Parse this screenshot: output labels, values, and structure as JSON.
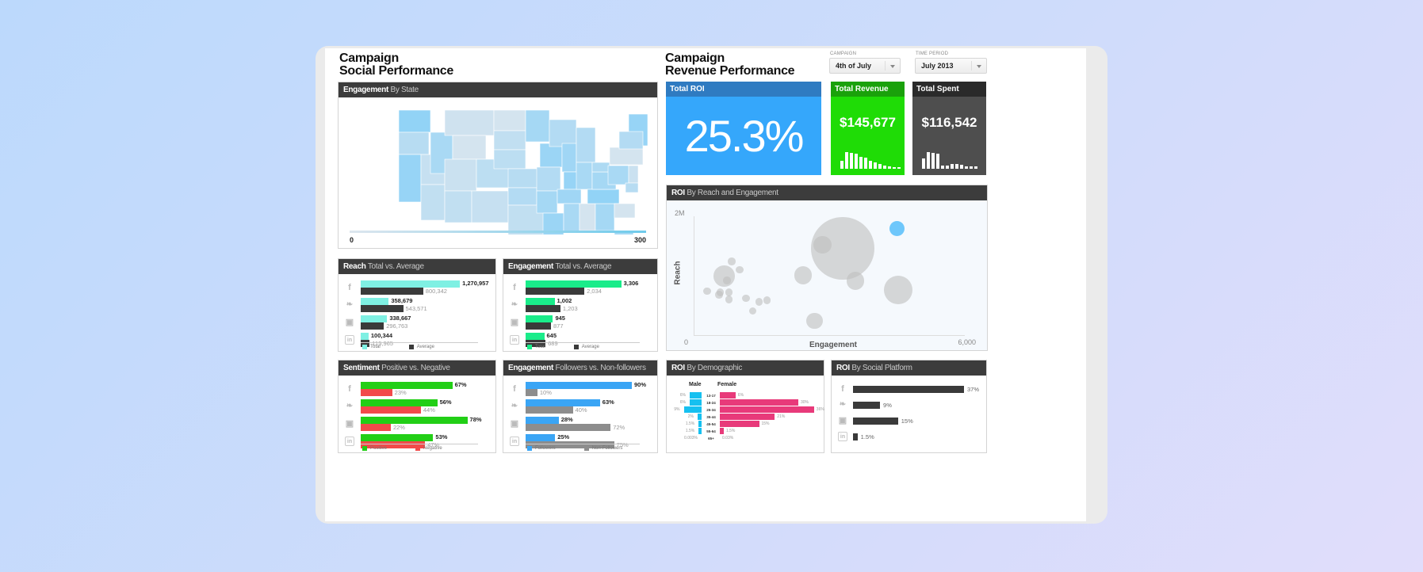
{
  "left_title": [
    "Campaign",
    "Social Performance"
  ],
  "right_title": [
    "Campaign",
    "Revenue Performance"
  ],
  "filters": {
    "campaign": {
      "label": "CAMPAIGN",
      "value": "4th of July"
    },
    "time_period": {
      "label": "TIME PERIOD",
      "value": "July 2013"
    }
  },
  "map_panel": {
    "title": "Engagement",
    "subtitle": "By State",
    "scale_min": "0",
    "scale_max": "300",
    "colors": {
      "low": "#dde6ee",
      "high": "#7fcef8"
    }
  },
  "kpis": {
    "roi": {
      "title": "Total ROI",
      "value": "25.3%",
      "color": "#35a7fb",
      "header_color": "#2f7bc1"
    },
    "revenue": {
      "title": "Total Revenue",
      "value": "$145,677",
      "color": "#1fdc06",
      "header_color": "#1aa10b",
      "spark": [
        0.35,
        0.75,
        0.72,
        0.68,
        0.55,
        0.5,
        0.35,
        0.3,
        0.2,
        0.15,
        0.12,
        0.08,
        0.05
      ]
    },
    "spent": {
      "title": "Total Spent",
      "value": "$116,542",
      "color": "#4e4e4e",
      "header_color": "#2a2a2a",
      "spark": [
        0.45,
        0.75,
        0.72,
        0.68,
        0.15,
        0.15,
        0.2,
        0.2,
        0.18,
        0.1,
        0.1,
        0.12
      ]
    }
  },
  "platforms": [
    "facebook",
    "twitter",
    "youtube",
    "linkedin"
  ],
  "platform_glyphs": [
    "f",
    "🐦",
    "▭",
    "in"
  ],
  "reach": {
    "title": "Reach",
    "subtitle": "Total vs. Average",
    "legend": [
      "Total",
      "Average"
    ],
    "colors": [
      "#7ff0e3",
      "#3a3a3a"
    ],
    "max": 1300000,
    "rows": [
      {
        "total": 1270957,
        "total_label": "1,270,957",
        "avg": 800342,
        "avg_label": "800,342"
      },
      {
        "total": 358679,
        "total_label": "358,679",
        "avg": 543571,
        "avg_label": "543,571"
      },
      {
        "total": 338667,
        "total_label": "338,667",
        "avg": 296763,
        "avg_label": "296,763"
      },
      {
        "total": 100344,
        "total_label": "100,344",
        "avg": 115965,
        "avg_label": "115,965"
      }
    ]
  },
  "engagement_total": {
    "title": "Engagement",
    "subtitle": "Total vs. Average",
    "legend": [
      "Total",
      "Average"
    ],
    "colors": [
      "#1aec8a",
      "#3a3a3a"
    ],
    "max": 3400,
    "rows": [
      {
        "total": 3306,
        "total_label": "3,306",
        "avg": 2034,
        "avg_label": "2,034"
      },
      {
        "total": 1002,
        "total_label": "1,002",
        "avg": 1203,
        "avg_label": "1,203"
      },
      {
        "total": 945,
        "total_label": "945",
        "avg": 877,
        "avg_label": "877"
      },
      {
        "total": 645,
        "total_label": "645",
        "avg": 689,
        "avg_label": "689"
      }
    ]
  },
  "sentiment": {
    "title": "Sentiment",
    "subtitle": "Positive vs. Negative",
    "legend": [
      "Positive",
      "Negative"
    ],
    "colors": [
      "#22cf16",
      "#f24a4a"
    ],
    "max": 80,
    "rows": [
      {
        "total": 67,
        "total_label": "67%",
        "avg": 23,
        "avg_label": "23%"
      },
      {
        "total": 56,
        "total_label": "56%",
        "avg": 44,
        "avg_label": "44%"
      },
      {
        "total": 78,
        "total_label": "78%",
        "avg": 22,
        "avg_label": "22%"
      },
      {
        "total": 53,
        "total_label": "53%",
        "avg": 47,
        "avg_label": "47%"
      }
    ]
  },
  "followers": {
    "title": "Engagement",
    "subtitle": "Followers vs. Non-followers",
    "legend": [
      "Followers",
      "Non-Followers"
    ],
    "colors": [
      "#3aa5f5",
      "#8d8d8d"
    ],
    "max": 90,
    "rows": [
      {
        "total": 90,
        "total_label": "90%",
        "avg": 10,
        "avg_label": "10%"
      },
      {
        "total": 63,
        "total_label": "63%",
        "avg": 40,
        "avg_label": "40%"
      },
      {
        "total": 28,
        "total_label": "28%",
        "avg": 72,
        "avg_label": "72%"
      },
      {
        "total": 25,
        "total_label": "25%",
        "avg": 75,
        "avg_label": "75%"
      }
    ]
  },
  "scatter": {
    "title": "ROI",
    "subtitle": "By Reach and Engagement",
    "xlabel": "Engagement",
    "ylabel": "Reach",
    "x_min_label": "0",
    "x_max_label": "6,000",
    "y_max_label": "2M",
    "xlim": [
      0,
      6000
    ],
    "ylim": [
      0,
      2000000
    ],
    "points": [
      {
        "x": 4500,
        "y": 1800000,
        "r": 1,
        "highlight": true
      },
      {
        "x": 3300,
        "y": 1460000,
        "r": 4.2
      },
      {
        "x": 2850,
        "y": 1520000,
        "r": 1.2
      },
      {
        "x": 2420,
        "y": 1010000,
        "r": 1.2
      },
      {
        "x": 3580,
        "y": 910000,
        "r": 1.2
      },
      {
        "x": 4530,
        "y": 760000,
        "r": 1.9
      },
      {
        "x": 2670,
        "y": 240000,
        "r": 1.1
      },
      {
        "x": 680,
        "y": 990000,
        "r": 1.4
      },
      {
        "x": 840,
        "y": 1240000,
        "r": 0.5
      },
      {
        "x": 1020,
        "y": 1100000,
        "r": 0.5
      },
      {
        "x": 300,
        "y": 740000,
        "r": 0.5
      },
      {
        "x": 590,
        "y": 720000,
        "r": 0.5
      },
      {
        "x": 780,
        "y": 720000,
        "r": 0.5
      },
      {
        "x": 780,
        "y": 600000,
        "r": 0.5
      },
      {
        "x": 1160,
        "y": 620000,
        "r": 0.5
      },
      {
        "x": 1450,
        "y": 560000,
        "r": 0.5
      },
      {
        "x": 1620,
        "y": 590000,
        "r": 0.5
      },
      {
        "x": 1310,
        "y": 410000,
        "r": 0.5
      },
      {
        "x": 740,
        "y": 920000,
        "r": 0.5
      },
      {
        "x": 560,
        "y": 680000,
        "r": 0.5
      }
    ]
  },
  "demographic": {
    "title": "ROI",
    "subtitle": "By Demographic",
    "male_label": "Male",
    "female_label": "Female",
    "male_color": "#16c0f0",
    "female_color": "#e83a7a",
    "rows": [
      {
        "age": "13-17",
        "male": 6,
        "male_label": "6%",
        "female": 6,
        "female_label": "6%"
      },
      {
        "age": "18-24",
        "male": 6,
        "male_label": "6%",
        "female": 30,
        "female_label": "30%"
      },
      {
        "age": "25-34",
        "male": 9,
        "male_label": "9%",
        "female": 36,
        "female_label": "36%"
      },
      {
        "age": "35-44",
        "male": 2,
        "male_label": "2%",
        "female": 21,
        "female_label": "21%"
      },
      {
        "age": "45-54",
        "male": 1.5,
        "male_label": "1.5%",
        "female": 15,
        "female_label": "15%"
      },
      {
        "age": "55-64",
        "male": 1.5,
        "male_label": "1.5%",
        "female": 1.5,
        "female_label": "1.5%"
      },
      {
        "age": "65+",
        "male": 0,
        "male_label": "0.003%",
        "female": 0,
        "female_label": "0.03%"
      }
    ]
  },
  "social_platform": {
    "title": "ROI",
    "subtitle": "By Social Platform",
    "color": "#3a3a3a",
    "max": 37,
    "rows": [
      {
        "value": 37,
        "label": "37%"
      },
      {
        "value": 9,
        "label": "9%"
      },
      {
        "value": 15,
        "label": "15%"
      },
      {
        "value": 1.5,
        "label": "1.5%"
      }
    ]
  }
}
